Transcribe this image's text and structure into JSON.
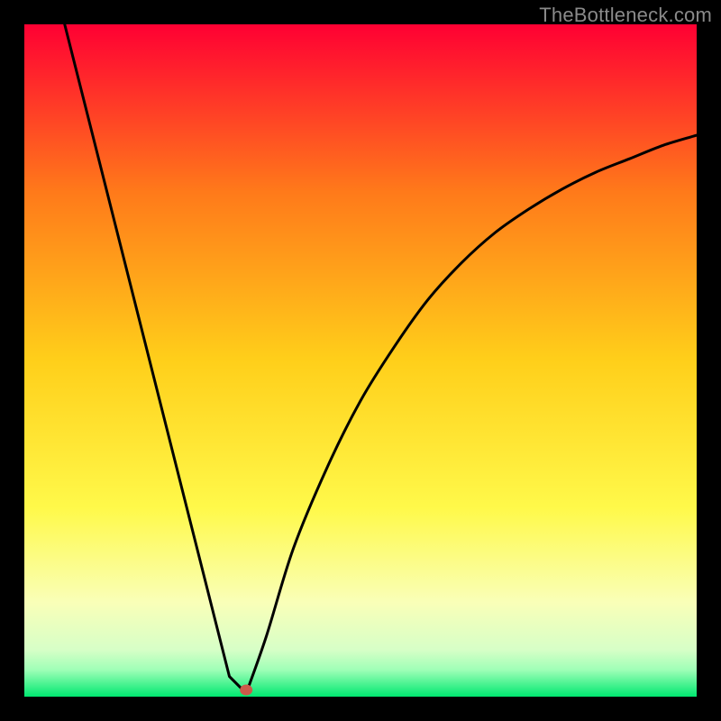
{
  "watermark": "TheBottleneck.com",
  "colors": {
    "frame": "#000000",
    "curve": "#000000",
    "marker": "#cc5a4a",
    "gradient_stops": [
      {
        "offset": 0.0,
        "color": "#ff0033"
      },
      {
        "offset": 0.25,
        "color": "#ff7a1a"
      },
      {
        "offset": 0.5,
        "color": "#ffcf1a"
      },
      {
        "offset": 0.72,
        "color": "#fff94a"
      },
      {
        "offset": 0.86,
        "color": "#f9ffb8"
      },
      {
        "offset": 0.93,
        "color": "#d7ffc7"
      },
      {
        "offset": 0.96,
        "color": "#9fffb7"
      },
      {
        "offset": 1.0,
        "color": "#00e870"
      }
    ]
  },
  "chart_data": {
    "type": "line",
    "title": "",
    "xlabel": "",
    "ylabel": "",
    "xlim": [
      0,
      100
    ],
    "ylim": [
      0,
      100
    ],
    "optimal_x": 33,
    "curve_left": {
      "description": "steep linear descent from top-left to the minimum",
      "points": [
        {
          "x": 6,
          "y": 100
        },
        {
          "x": 30.5,
          "y": 3
        },
        {
          "x": 33,
          "y": 0.5
        }
      ]
    },
    "curve_right": {
      "description": "concave rise from the minimum toward the right edge",
      "x": [
        33,
        36,
        40,
        45,
        50,
        55,
        60,
        65,
        70,
        75,
        80,
        85,
        90,
        95,
        100
      ],
      "y": [
        0.5,
        9,
        22,
        34,
        44,
        52,
        59,
        64.5,
        69,
        72.5,
        75.5,
        78,
        80,
        82,
        83.5
      ]
    },
    "marker": {
      "x": 33,
      "y": 1
    }
  }
}
